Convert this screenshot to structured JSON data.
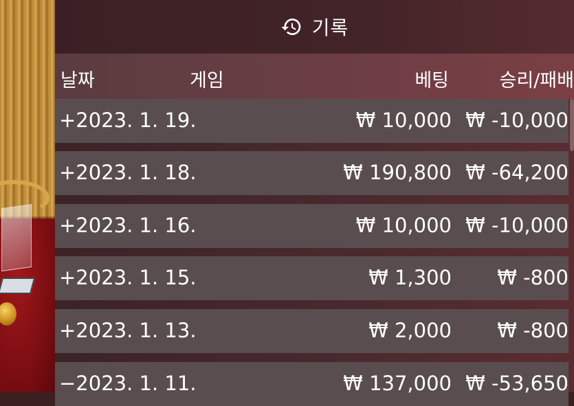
{
  "header": {
    "title": "기록",
    "icon": "history-icon"
  },
  "columns": {
    "date": "날짜",
    "game": "게임",
    "bet": "베팅",
    "result": "승리/패배"
  },
  "rows": [
    {
      "date": "+2023. 1. 19.",
      "bet": "₩ 10,000",
      "result": "₩ -10,000"
    },
    {
      "date": "+2023. 1. 18.",
      "bet": "₩ 190,800",
      "result": "₩ -64,200"
    },
    {
      "date": "+2023. 1. 16.",
      "bet": "₩ 10,000",
      "result": "₩ -10,000"
    },
    {
      "date": "+2023. 1. 15.",
      "bet": "₩ 1,300",
      "result": "₩ -800"
    },
    {
      "date": "+2023. 1. 13.",
      "bet": "₩ 2,000",
      "result": "₩ -800"
    },
    {
      "date": "−2023. 1. 11.",
      "bet": "₩ 137,000",
      "result": "₩ -53,650"
    }
  ]
}
